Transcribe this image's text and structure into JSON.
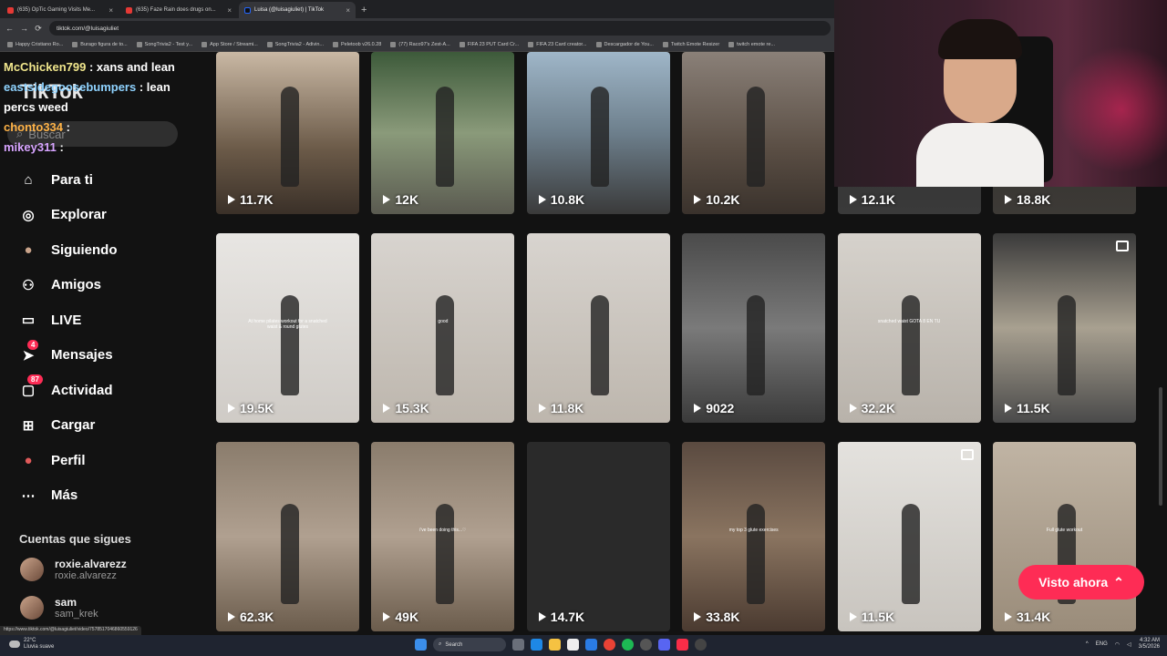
{
  "browser": {
    "tabs": [
      {
        "title": "(635) OpTic Gaming Visits Me...",
        "close": "×"
      },
      {
        "title": "(635) Faze Rain does drugs on...",
        "close": "×"
      },
      {
        "title": "Luisa (@luisagiuliet) | TikTok",
        "close": "×"
      }
    ],
    "new_tab": "+",
    "url": "tiktok.com/@luisagiuliet",
    "bookmarks": [
      "Happy Cristiano Ro...",
      "Burago figura de to...",
      "SongTrivia2 - Test y...",
      "App Store / Streami...",
      "SongTrivia2 - Adivin...",
      "Peletoob v26.0.28",
      "(77) Raco97's Zest-A...",
      "FIFA 23 PUT Card Cr...",
      "FIFA 23 Card creator...",
      "Descargador de You...",
      "Twitch Emote Resizer",
      "twitch emote re..."
    ]
  },
  "chat": [
    {
      "user": "McChicken799",
      "msg": ": xans and lean"
    },
    {
      "user": "eastsidegoosebumpers",
      "msg": ": lean percs weed"
    },
    {
      "user": "chonto334",
      "msg": ":"
    },
    {
      "user": "mikey311",
      "msg": ":"
    }
  ],
  "tiktok": {
    "logo": "TikTok",
    "search_placeholder": "Buscar",
    "nav": [
      {
        "label": "Para ti",
        "icon": "home-icon"
      },
      {
        "label": "Explorar",
        "icon": "compass-icon"
      },
      {
        "label": "Siguiendo",
        "icon": "avatar-icon"
      },
      {
        "label": "Amigos",
        "icon": "friends-icon"
      },
      {
        "label": "LIVE",
        "icon": "live-icon"
      },
      {
        "label": "Mensajes",
        "icon": "send-icon",
        "badge": "4"
      },
      {
        "label": "Actividad",
        "icon": "inbox-icon",
        "badge": "87"
      },
      {
        "label": "Cargar",
        "icon": "plus-square-icon"
      },
      {
        "label": "Perfil",
        "icon": "profile-avatar-icon"
      },
      {
        "label": "Más",
        "icon": "more-dots-icon"
      }
    ],
    "following_title": "Cuentas que sigues",
    "following": [
      {
        "name": "roxie.alvarezz",
        "handle": "roxie.alvarezz"
      },
      {
        "name": "sam",
        "handle": "sam_krek"
      }
    ],
    "videos": [
      {
        "views": "11.7K"
      },
      {
        "views": "12K"
      },
      {
        "views": "10.8K"
      },
      {
        "views": "10.2K"
      },
      {
        "views": "12.1K"
      },
      {
        "views": "18.8K"
      },
      {
        "views": "19.5K",
        "caption": "At home pilates workout for a snatched waist & round glutes"
      },
      {
        "views": "15.3K",
        "caption": "good"
      },
      {
        "views": "11.8K"
      },
      {
        "views": "9022"
      },
      {
        "views": "32.2K",
        "caption": "snatched waist GOTA 8 EN TU"
      },
      {
        "views": "11.5K",
        "multi": true
      },
      {
        "views": "62.3K"
      },
      {
        "views": "49K",
        "caption": "i've been doing this...♡"
      },
      {
        "views": "14.7K"
      },
      {
        "views": "33.8K",
        "caption": "my top 3 glute exercises"
      },
      {
        "views": "11.5K",
        "multi": true
      },
      {
        "views": "31.4K",
        "caption": "Full glute workout"
      }
    ],
    "visto_button": "Visto ahora",
    "status_url": "https://www.tiktok.com/@luisagiuliet/video/7578517046860559126"
  },
  "taskbar": {
    "weather_temp": "22°C",
    "weather_desc": "Lluvia suave",
    "search_label": "Search",
    "lang": "ENG",
    "time": "4:32 AM",
    "date": "3/5/2026"
  },
  "colors": {
    "accent": "#fe2c55",
    "bg": "#121212"
  }
}
